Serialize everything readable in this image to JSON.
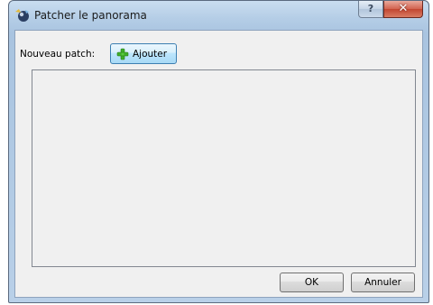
{
  "window": {
    "title": "Patcher le panorama",
    "help_label": "?",
    "close_label": "✕"
  },
  "main": {
    "patch_label": "Nouveau patch:",
    "add_label": "Ajouter"
  },
  "footer": {
    "ok_label": "OK",
    "cancel_label": "Annuler"
  },
  "icons": {
    "app": "panorama-app-icon",
    "add": "plus-icon"
  },
  "colors": {
    "title_bar": "#b4cde6",
    "close_button": "#c24631",
    "add_button": "#bee6fd",
    "plus_icon": "#3fae2a"
  }
}
